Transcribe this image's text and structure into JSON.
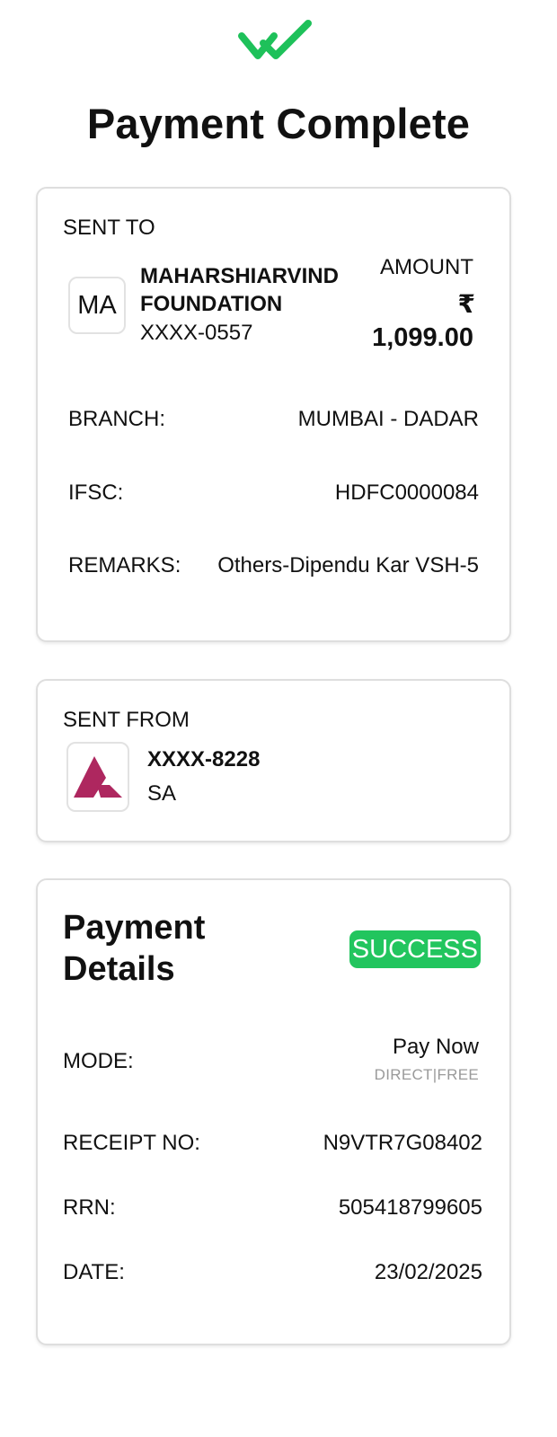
{
  "header": {
    "logo_icon": "double-check-icon",
    "title": "Payment Complete",
    "accent_color": "#1ec15a"
  },
  "sent_to": {
    "section_label": "SENT TO",
    "avatar_initials": "MA",
    "payee_name": "MAHARSHIARVIND FOUNDATION",
    "account": "XXXX-0557",
    "amount_label": "AMOUNT",
    "currency_symbol": "₹",
    "amount": "1,099.00",
    "rows": [
      {
        "key": "BRANCH:",
        "value": "MUMBAI - DADAR"
      },
      {
        "key": "IFSC:",
        "value": "HDFC0000084"
      },
      {
        "key": "REMARKS:",
        "value": "Others-Dipendu Kar VSH-5"
      }
    ]
  },
  "sent_from": {
    "section_label": "SENT FROM",
    "bank_icon": "axis-bank-logo-icon",
    "account": "XXXX-8228",
    "account_type": "SA"
  },
  "payment_details": {
    "title": "Payment Details",
    "status": "SUCCESS",
    "status_color": "#22c55e",
    "mode_label": "MODE:",
    "mode_value": "Pay Now",
    "mode_sub": "DIRECT|FREE",
    "rows": [
      {
        "key": "RECEIPT NO:",
        "value": "N9VTR7G08402"
      },
      {
        "key": "RRN:",
        "value": "505418799605"
      },
      {
        "key": "DATE:",
        "value": "23/02/2025"
      }
    ]
  }
}
